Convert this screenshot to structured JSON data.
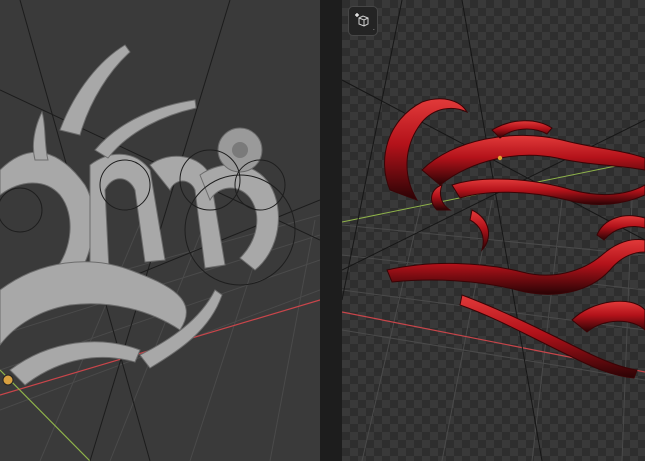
{
  "app": {
    "left_viewport": {
      "kind": "3d-viewport",
      "shading": "solid"
    },
    "right_viewport": {
      "kind": "3d-viewport",
      "shading": "rendered-transparent"
    },
    "colors": {
      "left_bg": "#3a3a3a",
      "right_bg": "#2e2e2e",
      "checker": "#393939",
      "divider": "#1d1d1d",
      "solid_model": "#a8a8a8",
      "chrome_red": "#b3121a",
      "chrome_dark": "#2a0305",
      "x_axis": "#c8454a",
      "y_axis": "#8fb34a",
      "grid": "#4a4a4a"
    },
    "icons": {
      "view_toggle": "add-camera-icon",
      "origin_marker": "origin-dot-icon"
    },
    "view_button_badge": "·"
  }
}
